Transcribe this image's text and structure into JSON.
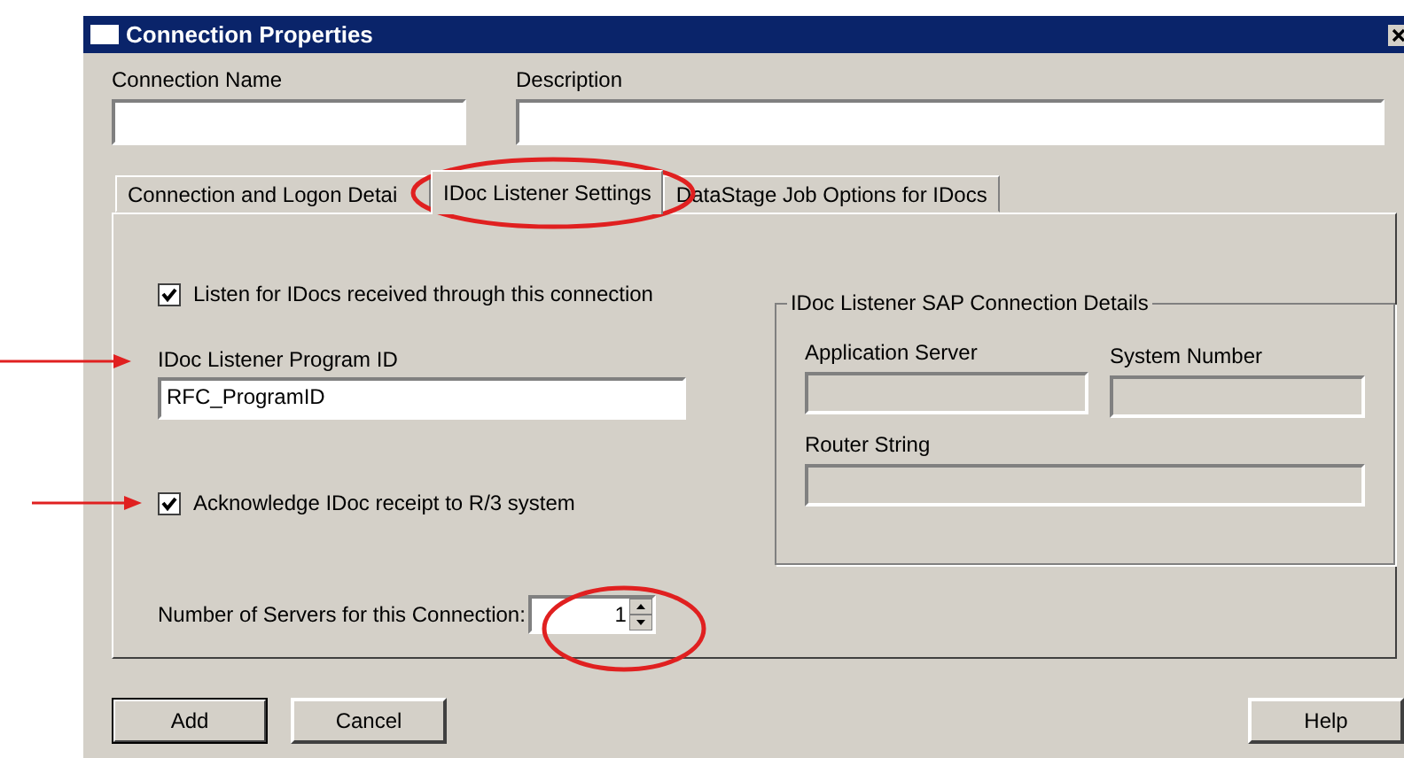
{
  "window": {
    "title": "Connection Properties"
  },
  "top_fields": [
    {
      "label": "Connection Name",
      "kind": "short"
    },
    {
      "label": "Description",
      "kind": "wide"
    }
  ],
  "tabs": [
    {
      "label": "Connection and Logon Detai",
      "selected": false
    },
    {
      "label": "IDoc Listener Settings",
      "selected": true
    },
    {
      "label": "DataStage Job Options for IDocs",
      "selected": false
    }
  ],
  "listen_checkbox": {
    "label": "Listen for IDocs received through this connection",
    "checked": true
  },
  "program_id": {
    "label": "IDoc Listener Program ID",
    "value": "RFC_ProgramID"
  },
  "acknowledge_checkbox": {
    "label": "Acknowledge IDoc receipt to R/3 system",
    "checked": true
  },
  "servers": {
    "label": "Number of Servers for this Connection:",
    "value": "1"
  },
  "sap_group": {
    "title": "IDoc Listener SAP Connection Details",
    "fields": [
      {
        "label": "Application Server",
        "disabled": true
      },
      {
        "label": "System Number",
        "disabled": true
      },
      {
        "label": "Router String",
        "disabled": true
      }
    ]
  },
  "buttons": [
    {
      "label": "Add",
      "default": true
    },
    {
      "label": "Cancel",
      "default": false
    },
    {
      "label": "Help",
      "default": false
    }
  ]
}
